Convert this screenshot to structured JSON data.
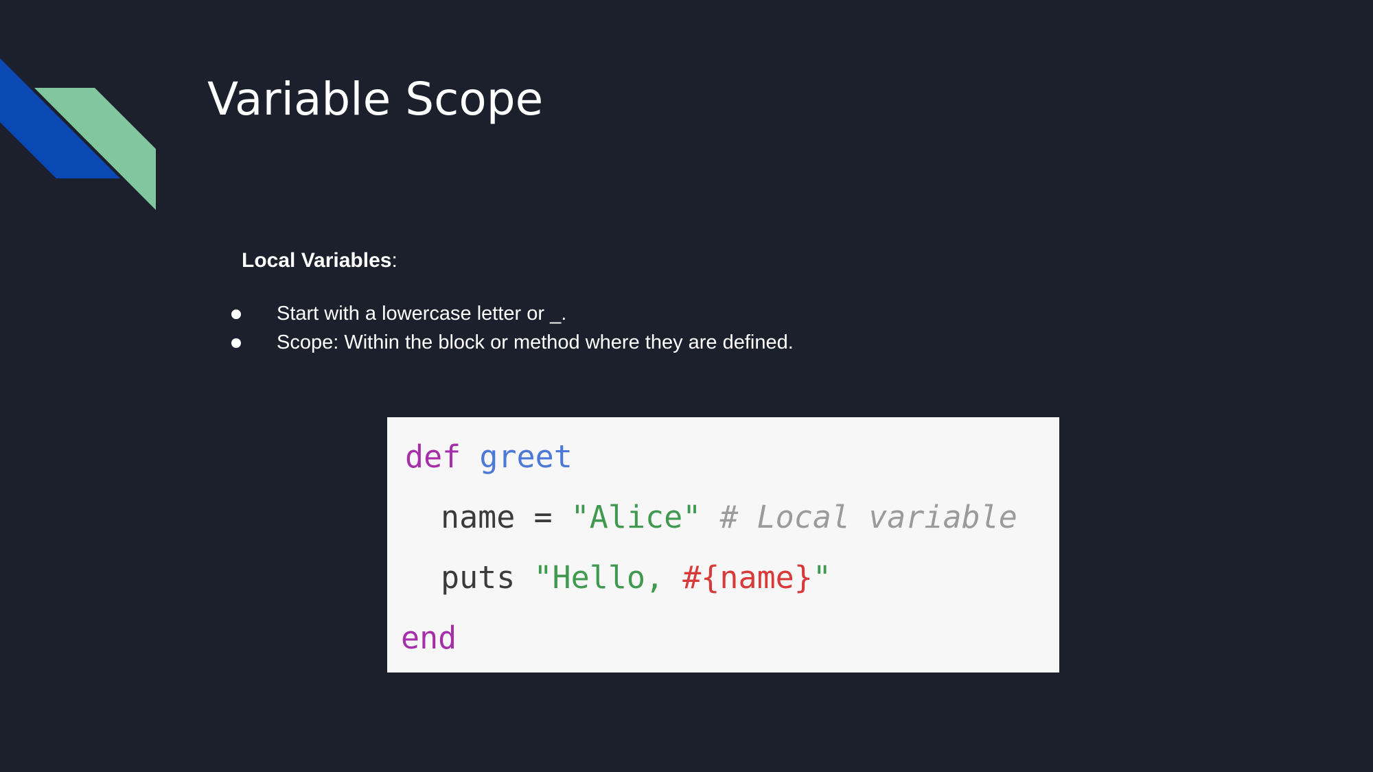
{
  "slide": {
    "title": "Variable Scope",
    "subheading_bold": "Local Variables",
    "subheading_suffix": ":",
    "bullets": [
      "Start with a lowercase letter or _.",
      "Scope: Within the block or method where they are defined."
    ]
  },
  "code": {
    "line1": {
      "keyword": "def",
      "name": "greet"
    },
    "line2": {
      "var": "name",
      "op": "=",
      "string": "\"Alice\"",
      "comment": "# Local variable"
    },
    "line3": {
      "method": "puts",
      "string_open": "\"Hello, ",
      "interpolation": "#{name}",
      "string_close": "\""
    },
    "line4": {
      "keyword": "end"
    }
  },
  "colors": {
    "background": "#1b202c",
    "accent_blue": "#0a48b3",
    "accent_green": "#82c6a0",
    "code_keyword": "#a52fa8",
    "code_function": "#4c78d8",
    "code_string": "#3f9a4f",
    "code_interpolation": "#d83a3a",
    "code_comment": "#9b9b9b"
  }
}
